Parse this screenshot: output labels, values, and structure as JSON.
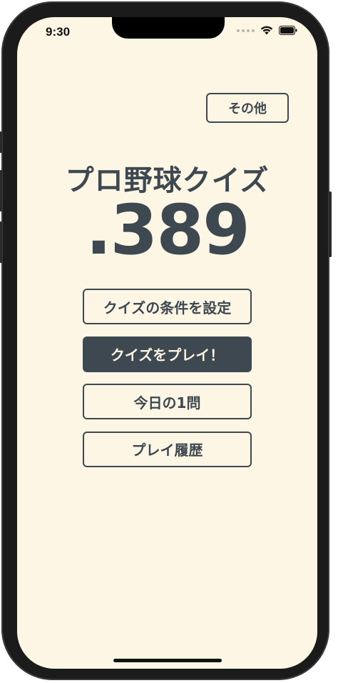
{
  "status_bar": {
    "time": "9:30"
  },
  "header": {
    "other_label": "その他"
  },
  "hero": {
    "title": "プロ野球クイズ",
    "logo_text": ".389"
  },
  "menu": {
    "quiz_settings": "クイズの条件を設定",
    "play_quiz": "クイズをプレイ！",
    "daily_question": "今日の1問",
    "play_history": "プレイ履歴"
  },
  "colors": {
    "background": "#fdf6e4",
    "accent": "#3d4850"
  },
  "icons": {
    "wifi": "wifi-icon",
    "battery": "battery-icon",
    "signal": "cellular-signal-icon"
  }
}
